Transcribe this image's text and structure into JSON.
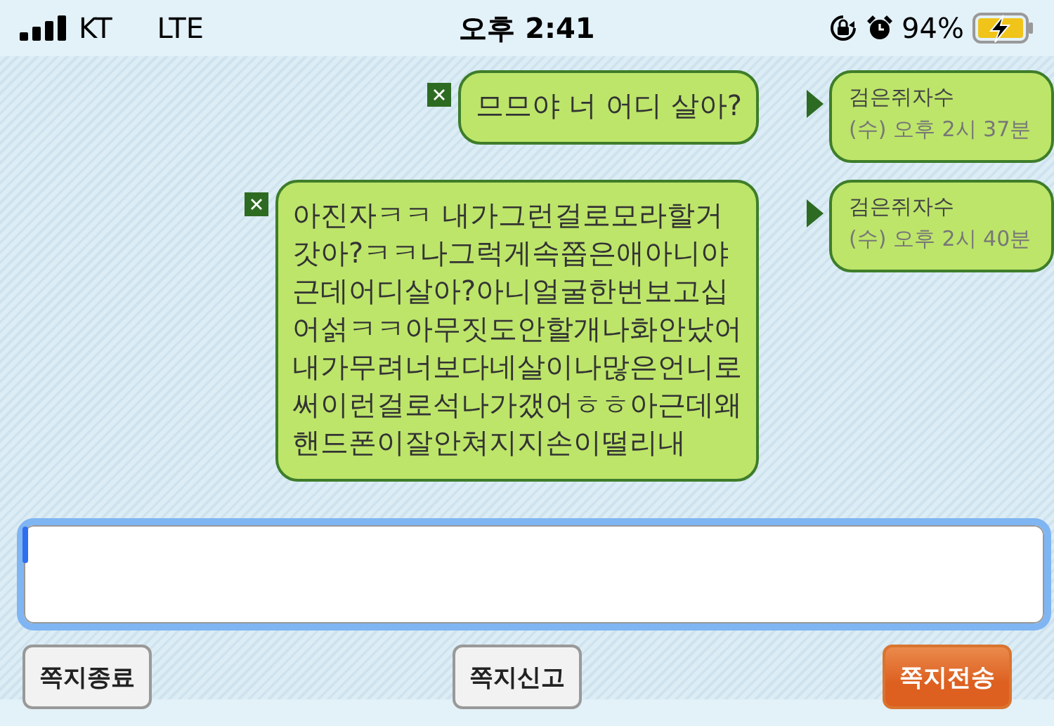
{
  "status_bar": {
    "carrier": "KT",
    "network": "LTE",
    "time": "오후 2:41",
    "battery": "94%"
  },
  "messages": [
    {
      "text": "므므야 너 어디 살아?",
      "sender": "검은쥐자수",
      "time": "(수) 오후 2시 37분"
    },
    {
      "text": "아진자ㅋㅋ 내가그런걸로모라할거\n갓아?ㅋㅋ나그럭게속쫍은애아니야\n근데어디살아?아니얼굴한번보고십\n어섥ㅋㅋ아무짓도안할개나화안났어\n내가무려너보다네살이나많은언니로\n써이런걸로석나가갰어ㅎㅎ아근데왜\n핸드폰이잘안쳐지지손이떨리내",
      "sender": "검은쥐자수",
      "time": "(수) 오후 2시 40분"
    }
  ],
  "buttons": [
    {
      "label": "쪽지종료",
      "kind": "plain"
    },
    {
      "label": "쪽지신고",
      "kind": "plain"
    },
    {
      "label": "쪽지전송",
      "kind": "primary"
    }
  ]
}
